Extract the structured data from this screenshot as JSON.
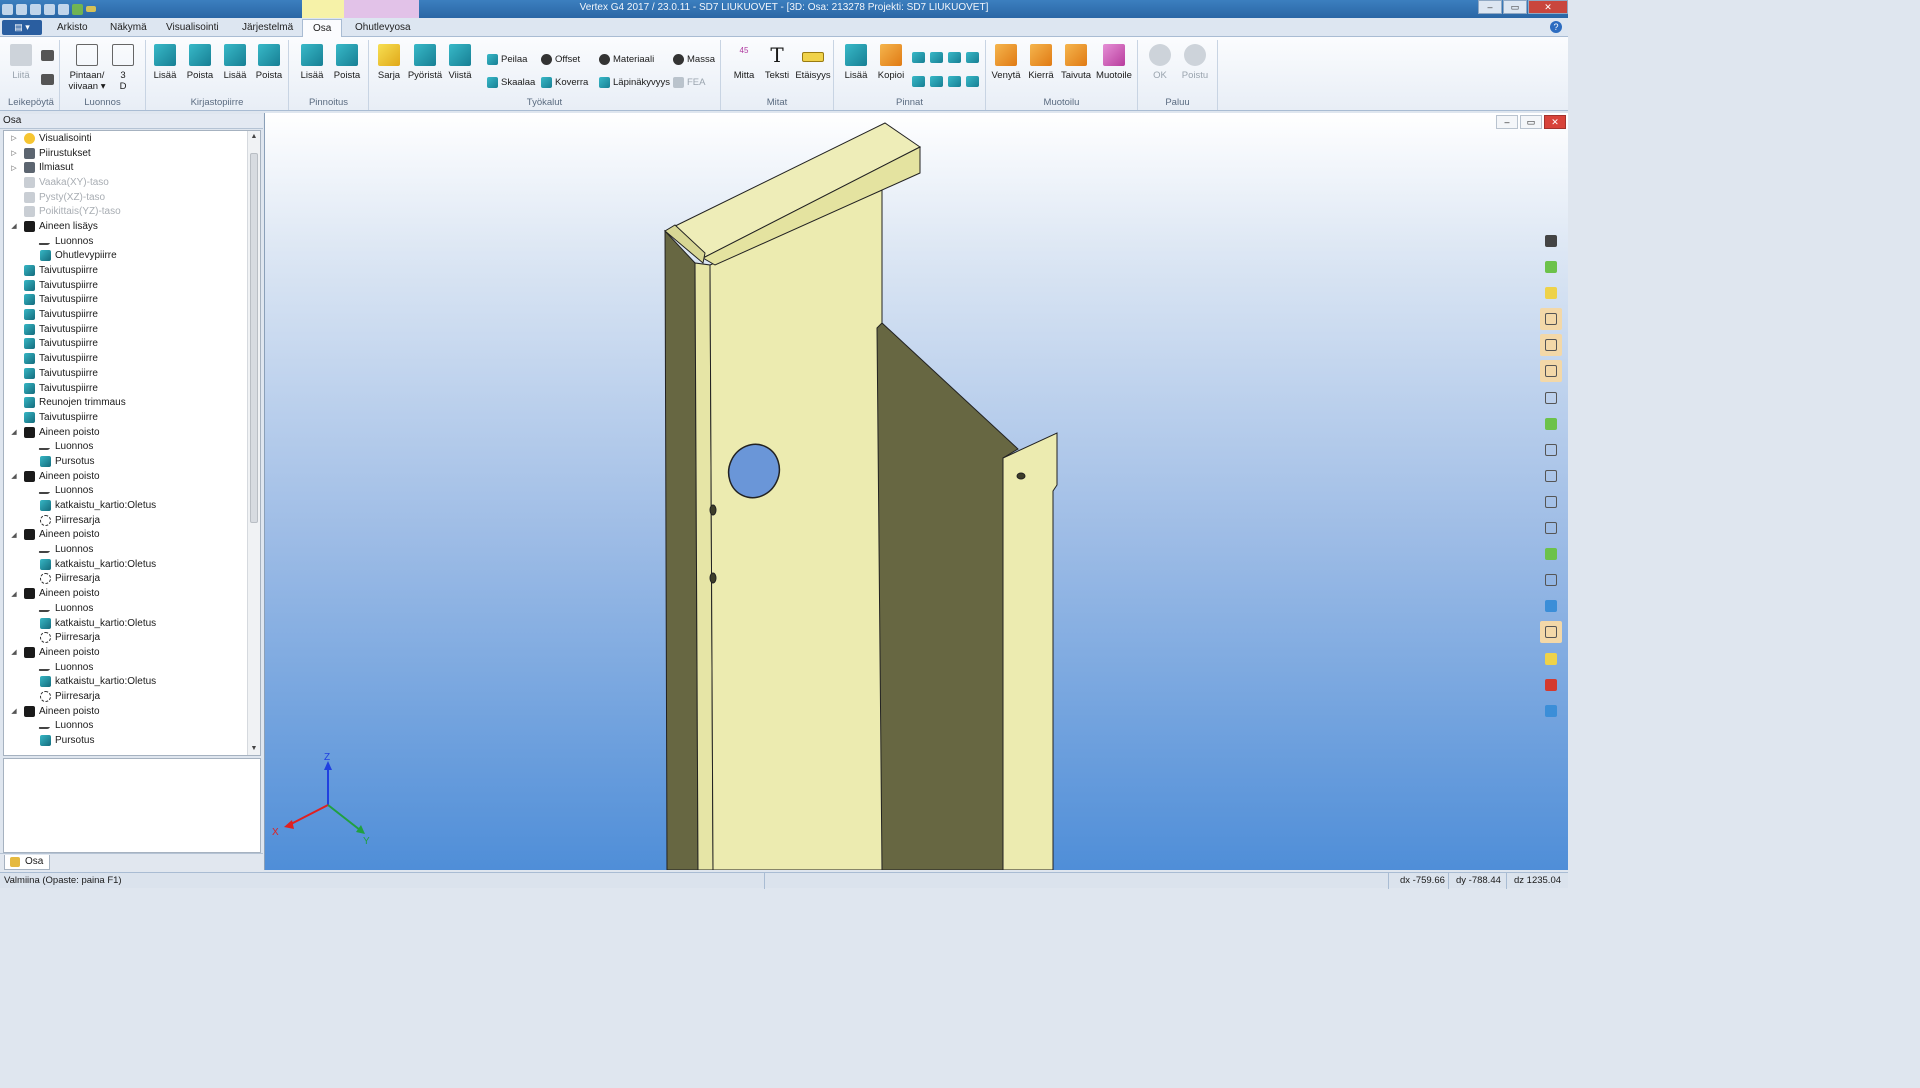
{
  "window": {
    "title": "Vertex G4 2017 / 23.0.11 - SD7 LIUKUOVET - [3D: Osa: 213278  Projekti: SD7 LIUKUOVET]",
    "minimize": "–",
    "maximize": "▭",
    "close": "✕"
  },
  "ribbon_tabs": [
    {
      "label": "Arkisto"
    },
    {
      "label": "Näkymä"
    },
    {
      "label": "Visualisointi"
    },
    {
      "label": "Järjestelmä"
    },
    {
      "label": "Osa"
    },
    {
      "label": "Ohutlevyosa"
    }
  ],
  "active_tab": "Osa",
  "app_button": "▤ ▾",
  "help": "?",
  "ribbon_groups": {
    "leikepoyta": {
      "label": "Leikepöytä",
      "liita": "Liitä"
    },
    "luonnos": {
      "label": "Luonnos",
      "pintaan": "Pintaan/",
      "viivaan": "viivaan ▾",
      "three": "3",
      "d": "D"
    },
    "kirjastopiirre": {
      "label": "Kirjastopiirre",
      "b1": "Lisää",
      "b2": "Poista",
      "b3": "Lisää",
      "b4": "Poista"
    },
    "pinnoitus": {
      "label": "Pinnoitus",
      "b1": "Lisää",
      "b2": "Poista"
    },
    "tyokalut": {
      "label": "Työkalut",
      "sarja": "Sarja",
      "pyorista": "Pyöristä",
      "viista": "Viistä",
      "peilaa": "Peilaa",
      "offset": "Offset",
      "skaalaa": "Skaalaa",
      "koverra": "Koverra",
      "materiaali": "Materiaali",
      "massa": "Massa",
      "lapinakyvyys": "Läpinäkyvyys",
      "fea": "FEA"
    },
    "mitat": {
      "label": "Mitat",
      "mitta": "Mitta",
      "teksti": "Teksti",
      "etaisyys": "Etäisyys",
      "mitta_num": "45",
      "teksti_glyph": "T"
    },
    "pinnat": {
      "label": "Pinnat",
      "lisaa": "Lisää",
      "kopioi": "Kopioi"
    },
    "muotoilu": {
      "label": "Muotoilu",
      "venyta": "Venytä",
      "kierra": "Kierrä",
      "taivuta": "Taivuta",
      "muotoile": "Muotoile"
    },
    "paluu": {
      "label": "Paluu",
      "ok": "OK",
      "poistu": "Poistu"
    }
  },
  "panel": {
    "header": "Osa",
    "tab_label": "Osa",
    "tree": [
      {
        "label": "Visualisointi",
        "level": 0,
        "exp": "▷",
        "icon": "sun"
      },
      {
        "label": "Piirustukset",
        "level": 0,
        "exp": "▷",
        "icon": "doc"
      },
      {
        "label": "Ilmiasut",
        "level": 0,
        "exp": "▷",
        "icon": "doc"
      },
      {
        "label": "Vaaka(XY)-taso",
        "level": 0,
        "exp": "",
        "icon": "dim",
        "dim": true
      },
      {
        "label": "Pysty(XZ)-taso",
        "level": 0,
        "exp": "",
        "icon": "dim",
        "dim": true
      },
      {
        "label": "Poikittais(YZ)-taso",
        "level": 0,
        "exp": "",
        "icon": "dim",
        "dim": true
      },
      {
        "label": "Aineen lisäys",
        "level": 0,
        "exp": "◢",
        "icon": "cut"
      },
      {
        "label": "Luonnos",
        "level": 1,
        "exp": "",
        "icon": "sketch"
      },
      {
        "label": "Ohutlevypiirre",
        "level": 1,
        "exp": "",
        "icon": "teal"
      },
      {
        "label": "Taivutuspiirre",
        "level": 0,
        "exp": "",
        "icon": "teal"
      },
      {
        "label": "Taivutuspiirre",
        "level": 0,
        "exp": "",
        "icon": "teal"
      },
      {
        "label": "Taivutuspiirre",
        "level": 0,
        "exp": "",
        "icon": "teal"
      },
      {
        "label": "Taivutuspiirre",
        "level": 0,
        "exp": "",
        "icon": "teal"
      },
      {
        "label": "Taivutuspiirre",
        "level": 0,
        "exp": "",
        "icon": "teal"
      },
      {
        "label": "Taivutuspiirre",
        "level": 0,
        "exp": "",
        "icon": "teal"
      },
      {
        "label": "Taivutuspiirre",
        "level": 0,
        "exp": "",
        "icon": "teal"
      },
      {
        "label": "Taivutuspiirre",
        "level": 0,
        "exp": "",
        "icon": "teal"
      },
      {
        "label": "Taivutuspiirre",
        "level": 0,
        "exp": "",
        "icon": "teal"
      },
      {
        "label": "Reunojen trimmaus",
        "level": 0,
        "exp": "",
        "icon": "teal"
      },
      {
        "label": "Taivutuspiirre",
        "level": 0,
        "exp": "",
        "icon": "teal"
      },
      {
        "label": "Aineen poisto",
        "level": 0,
        "exp": "◢",
        "icon": "cut"
      },
      {
        "label": "Luonnos",
        "level": 1,
        "exp": "",
        "icon": "sketch"
      },
      {
        "label": "Pursotus",
        "level": 1,
        "exp": "",
        "icon": "teal"
      },
      {
        "label": "Aineen poisto",
        "level": 0,
        "exp": "◢",
        "icon": "cut"
      },
      {
        "label": "Luonnos",
        "level": 1,
        "exp": "",
        "icon": "sketch"
      },
      {
        "label": "katkaistu_kartio:Oletus",
        "level": 1,
        "exp": "",
        "icon": "teal"
      },
      {
        "label": "Piirresarja",
        "level": 1,
        "exp": "",
        "icon": "cross"
      },
      {
        "label": "Aineen poisto",
        "level": 0,
        "exp": "◢",
        "icon": "cut"
      },
      {
        "label": "Luonnos",
        "level": 1,
        "exp": "",
        "icon": "sketch"
      },
      {
        "label": "katkaistu_kartio:Oletus",
        "level": 1,
        "exp": "",
        "icon": "teal"
      },
      {
        "label": "Piirresarja",
        "level": 1,
        "exp": "",
        "icon": "cross"
      },
      {
        "label": "Aineen poisto",
        "level": 0,
        "exp": "◢",
        "icon": "cut"
      },
      {
        "label": "Luonnos",
        "level": 1,
        "exp": "",
        "icon": "sketch"
      },
      {
        "label": "katkaistu_kartio:Oletus",
        "level": 1,
        "exp": "",
        "icon": "teal"
      },
      {
        "label": "Piirresarja",
        "level": 1,
        "exp": "",
        "icon": "cross"
      },
      {
        "label": "Aineen poisto",
        "level": 0,
        "exp": "◢",
        "icon": "cut"
      },
      {
        "label": "Luonnos",
        "level": 1,
        "exp": "",
        "icon": "sketch"
      },
      {
        "label": "katkaistu_kartio:Oletus",
        "level": 1,
        "exp": "",
        "icon": "teal"
      },
      {
        "label": "Piirresarja",
        "level": 1,
        "exp": "",
        "icon": "cross"
      },
      {
        "label": "Aineen poisto",
        "level": 0,
        "exp": "◢",
        "icon": "cut"
      },
      {
        "label": "Luonnos",
        "level": 1,
        "exp": "",
        "icon": "sketch"
      },
      {
        "label": "Pursotus",
        "level": 1,
        "exp": "",
        "icon": "teal"
      }
    ]
  },
  "viewport": {
    "axis": {
      "x": "X",
      "y": "Y",
      "z": "Z"
    },
    "colors": {
      "part_face": "#ecebb0",
      "part_dark": "#676742",
      "axis_x": "#e02020",
      "axis_y": "#20a040",
      "axis_z": "#2040e0"
    }
  },
  "side_toolbar": [
    {
      "icon": "pin-icon",
      "active": false,
      "tone": "dark"
    },
    {
      "icon": "rotate-view-icon",
      "active": false,
      "tone": "green"
    },
    {
      "icon": "ruler-icon",
      "active": false,
      "tone": "yellow"
    },
    {
      "icon": "select-point-icon",
      "active": true,
      "tone": "outline"
    },
    {
      "icon": "select-edge-icon",
      "active": true,
      "tone": "outline"
    },
    {
      "icon": "select-face-icon",
      "active": true,
      "tone": "outline"
    },
    {
      "icon": "select-feature-icon",
      "active": false,
      "tone": "outline"
    },
    {
      "icon": "shaded-view-icon",
      "active": false,
      "tone": "green"
    },
    {
      "icon": "wireframe-view-icon",
      "active": false,
      "tone": "outline"
    },
    {
      "icon": "hidden-lines-icon",
      "active": false,
      "tone": "outline"
    },
    {
      "icon": "edges-view-icon",
      "active": false,
      "tone": "outline"
    },
    {
      "icon": "transparent-view-icon",
      "active": false,
      "tone": "outline"
    },
    {
      "icon": "green-cube-icon",
      "active": false,
      "tone": "green"
    },
    {
      "icon": "list-icon",
      "active": false,
      "tone": "outline"
    },
    {
      "icon": "sheet-metal-icon",
      "active": false,
      "tone": "blue"
    },
    {
      "icon": "sketch-plane-icon",
      "active": true,
      "tone": "outline"
    },
    {
      "icon": "layers-icon",
      "active": false,
      "tone": "yellow"
    },
    {
      "icon": "delete-layer-icon",
      "active": false,
      "tone": "red"
    },
    {
      "icon": "export-icon",
      "active": false,
      "tone": "blue"
    }
  ],
  "status": {
    "message": "Valmiina (Opaste: paina F1)",
    "dx": "dx -759.66",
    "dy": "dy -788.44",
    "dz": "dz 1235.04"
  }
}
